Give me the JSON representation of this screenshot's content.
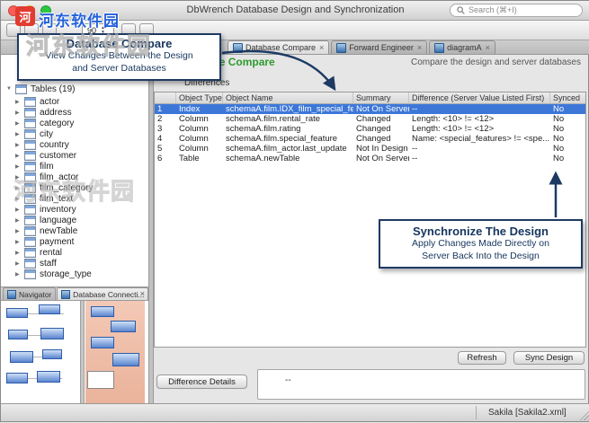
{
  "window": {
    "title": "DbWrench Database Design and Synchronization",
    "search": {
      "placeholder": "Search (⌘+I)"
    }
  },
  "watermark": {
    "icon_char": "河",
    "brand": "河东软件园",
    "brand_faint": "河东软件园"
  },
  "toolbar": {
    "zoom_value": "90"
  },
  "tabs": {
    "items": [
      {
        "label": "Database Compare",
        "active": true
      },
      {
        "label": "Forward Engineer",
        "active": false
      },
      {
        "label": "diagramA",
        "active": false
      }
    ]
  },
  "compare_panel": {
    "title": "Database Compare",
    "description": "Compare the design and server databases",
    "section_label": "Differences"
  },
  "tree": {
    "root": "Tables (19)",
    "items": [
      "actor",
      "address",
      "category",
      "city",
      "country",
      "customer",
      "film",
      "film_actor",
      "film_category",
      "film_text",
      "inventory",
      "language",
      "newTable",
      "payment",
      "rental",
      "staff",
      "storage_type"
    ]
  },
  "diff_table": {
    "columns": [
      "",
      "Object Type",
      "Object Name",
      "Summary",
      "Difference (Server Value Listed First)",
      "Synced"
    ],
    "rows": [
      {
        "num": "1",
        "type": "Index",
        "name": "schemaA.film.IDX_film_special_feat...",
        "summary": "Not On Server",
        "difference": "--",
        "synced": "No",
        "selected": true
      },
      {
        "num": "2",
        "type": "Column",
        "name": "schemaA.film.rental_rate",
        "summary": "Changed",
        "difference": "Length: <10> != <12>",
        "synced": "No",
        "selected": false
      },
      {
        "num": "3",
        "type": "Column",
        "name": "schemaA.film.rating",
        "summary": "Changed",
        "difference": "Length: <10> != <12>",
        "synced": "No",
        "selected": false
      },
      {
        "num": "4",
        "type": "Column",
        "name": "schemaA.film.special_feature",
        "summary": "Changed",
        "difference": "Name: <special_features> != <spe...",
        "synced": "No",
        "selected": false
      },
      {
        "num": "5",
        "type": "Column",
        "name": "schemaA.film_actor.last_update",
        "summary": "Not In Design",
        "difference": "--",
        "synced": "No",
        "selected": false
      },
      {
        "num": "6",
        "type": "Table",
        "name": "schemaA.newTable",
        "summary": "Not On Server",
        "difference": "--",
        "synced": "No",
        "selected": false
      }
    ]
  },
  "callouts": {
    "compare": {
      "title": "Database Compare",
      "line1": "View Changes Between the Design",
      "line2": "and Server Databases"
    },
    "sync": {
      "title": "Synchronize The Design",
      "line1": "Apply Changes Made Directly on",
      "line2": "Server Back Into the Design"
    }
  },
  "buttons": {
    "refresh": "Refresh",
    "sync_design": "Sync Design",
    "difference_details": "Difference Details"
  },
  "details": {
    "text": "--"
  },
  "bottom_panel": {
    "tabs": [
      {
        "label": "Navigator",
        "active": false
      },
      {
        "label": "Database Connecti...",
        "active": true
      }
    ]
  },
  "status_bar": {
    "document": "Sakila [Sakila2.xml]"
  }
}
